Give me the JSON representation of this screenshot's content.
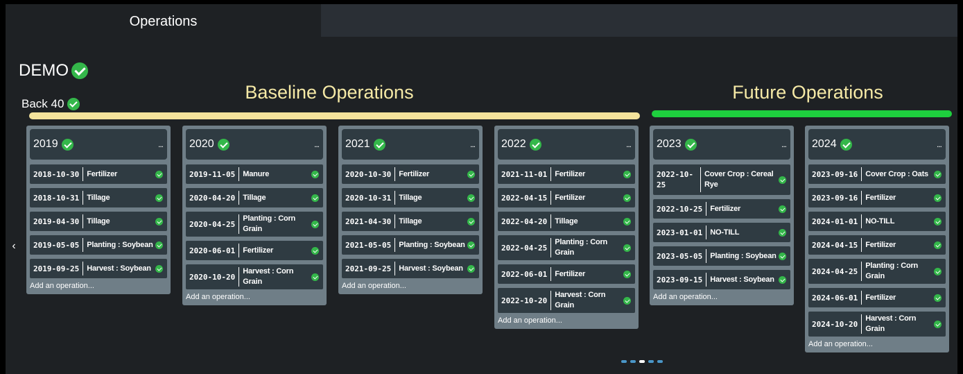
{
  "tabs": [
    {
      "label": "Operations",
      "active": true
    }
  ],
  "farm": {
    "name": "DEMO",
    "status": "check"
  },
  "field": {
    "name": "Back 40",
    "status": "check"
  },
  "sections": {
    "baseline": {
      "title": "Baseline Operations",
      "color": "#f3e29b"
    },
    "future": {
      "title": "Future Operations",
      "color": "#1ecf3e"
    }
  },
  "nav": {
    "prev": "‹"
  },
  "add_label": "Add an operation...",
  "menu_label": "...",
  "years": [
    {
      "year": "2019",
      "ops": [
        {
          "date": "2018-10-30",
          "name": "Fertilizer"
        },
        {
          "date": "2018-10-31",
          "name": "Tillage"
        },
        {
          "date": "2019-04-30",
          "name": "Tillage"
        },
        {
          "date": "2019-05-05",
          "name": "Planting : Soybean"
        },
        {
          "date": "2019-09-25",
          "name": "Harvest : Soybean"
        }
      ]
    },
    {
      "year": "2020",
      "ops": [
        {
          "date": "2019-11-05",
          "name": "Manure"
        },
        {
          "date": "2020-04-20",
          "name": "Tillage"
        },
        {
          "date": "2020-04-25",
          "name": "Planting : Corn Grain"
        },
        {
          "date": "2020-06-01",
          "name": "Fertilizer"
        },
        {
          "date": "2020-10-20",
          "name": "Harvest : Corn Grain"
        }
      ]
    },
    {
      "year": "2021",
      "ops": [
        {
          "date": "2020-10-30",
          "name": "Fertilizer"
        },
        {
          "date": "2020-10-31",
          "name": "Tillage"
        },
        {
          "date": "2021-04-30",
          "name": "Tillage"
        },
        {
          "date": "2021-05-05",
          "name": "Planting : Soybean"
        },
        {
          "date": "2021-09-25",
          "name": "Harvest : Soybean"
        }
      ]
    },
    {
      "year": "2022",
      "ops": [
        {
          "date": "2021-11-01",
          "name": "Fertilizer"
        },
        {
          "date": "2022-04-15",
          "name": "Fertilizer"
        },
        {
          "date": "2022-04-20",
          "name": "Tillage"
        },
        {
          "date": "2022-04-25",
          "name": "Planting : Corn Grain"
        },
        {
          "date": "2022-06-01",
          "name": "Fertilizer"
        },
        {
          "date": "2022-10-20",
          "name": "Harvest : Corn Grain"
        }
      ]
    },
    {
      "year": "2023",
      "ops": [
        {
          "date": "2022-10-25",
          "name": "Cover Crop : Cereal Rye"
        },
        {
          "date": "2022-10-25",
          "name": "Fertilizer"
        },
        {
          "date": "2023-01-01",
          "name": "NO-TILL"
        },
        {
          "date": "2023-05-05",
          "name": "Planting : Soybean"
        },
        {
          "date": "2023-09-15",
          "name": "Harvest : Soybean"
        }
      ]
    },
    {
      "year": "2024",
      "ops": [
        {
          "date": "2023-09-16",
          "name": "Cover Crop : Oats"
        },
        {
          "date": "2023-09-16",
          "name": "Fertilizer"
        },
        {
          "date": "2024-01-01",
          "name": "NO-TILL"
        },
        {
          "date": "2024-04-15",
          "name": "Fertilizer"
        },
        {
          "date": "2024-04-25",
          "name": "Planting : Corn Grain"
        },
        {
          "date": "2024-06-01",
          "name": "Fertilizer"
        },
        {
          "date": "2024-10-20",
          "name": "Harvest : Corn Grain"
        }
      ]
    }
  ],
  "pagination": {
    "count": 5,
    "active_index": 2
  },
  "colors": {
    "check": "#34b74a",
    "card": "#6f7e87",
    "card_inner": "#2f3b42",
    "background": "#1e2124"
  }
}
